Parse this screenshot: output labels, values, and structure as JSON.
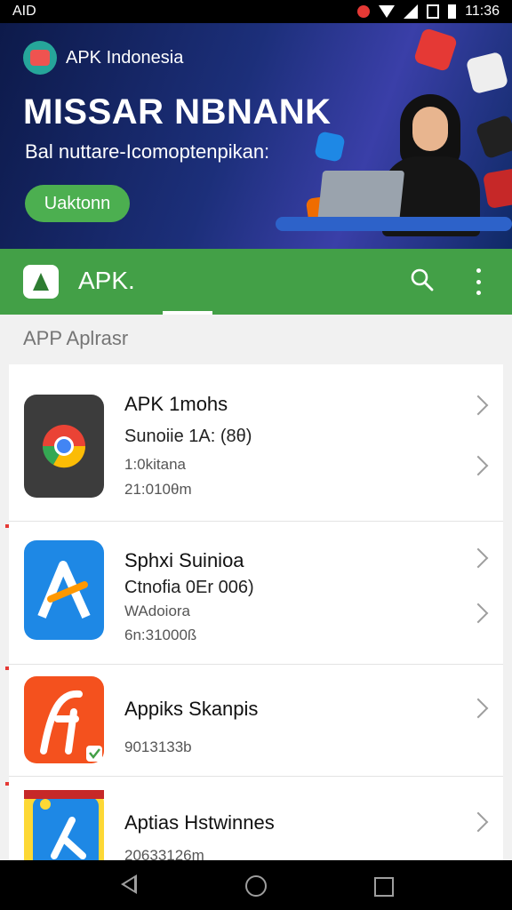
{
  "status_bar": {
    "left_text": "AID",
    "time": "11:36"
  },
  "banner": {
    "brand_name": "APK Indonesia",
    "headline": "MISSAR NBNANK",
    "subtitle": "Bal nuttare-Icomoptenpikan:",
    "cta_label": "Uaktonn"
  },
  "app_bar": {
    "title": "APK."
  },
  "section": {
    "title": "APP Aplrasr"
  },
  "apps": [
    {
      "name": "APK 1mohs",
      "detail": "Sunoiie 1A: (8θ)",
      "line3": "1:0kitana",
      "line4": "21:010θm",
      "icon": "chrome-app-icon"
    },
    {
      "name": "Sphxi Suinioa",
      "detail": "Ctnofia 0Er 006)",
      "line3": "WAdoiora",
      "line4": "6n:31000ß",
      "icon": "blue-app-icon"
    },
    {
      "name": "Appiks Skanpis",
      "detail": "",
      "line3": "",
      "line4": "9013133b",
      "icon": "orange-app-icon"
    },
    {
      "name": "Aptias Hstwinnes",
      "detail": "",
      "line3": "",
      "line4": "20633126m",
      "icon": "blue-yellow-app-icon"
    }
  ],
  "colors": {
    "accent_green": "#43a047",
    "banner_navy": "#1c2f7a"
  }
}
